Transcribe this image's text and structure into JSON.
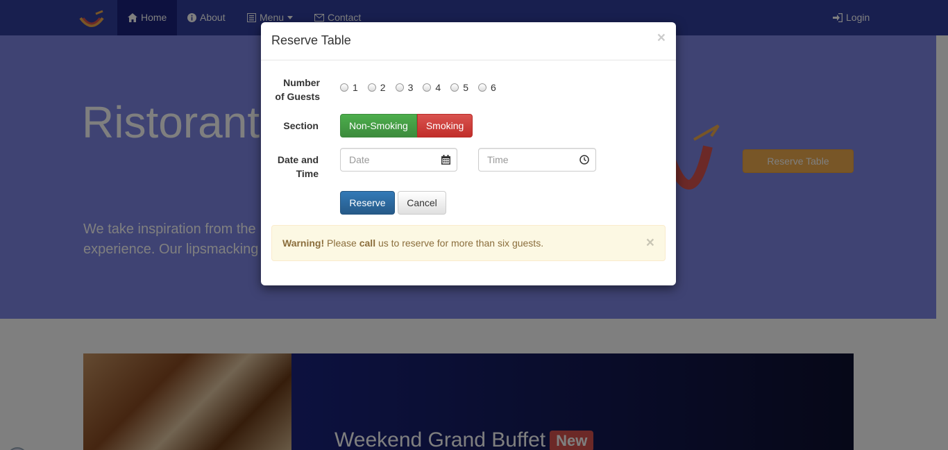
{
  "navbar": {
    "items": [
      {
        "label": "Home",
        "icon": "home-icon"
      },
      {
        "label": "About",
        "icon": "info-icon"
      },
      {
        "label": "Menu",
        "icon": "list-icon"
      },
      {
        "label": "Contact",
        "icon": "envelope-icon"
      }
    ],
    "login_label": "Login"
  },
  "jumbotron": {
    "title": "Ristorante",
    "text_line1": "We take inspiration from the",
    "text_line2": "experience. Our lipsmacking",
    "reserve_label": "Reserve Table"
  },
  "featured": {
    "title": "Weekend Grand Buffet",
    "badge": "New"
  },
  "modal": {
    "title": "Reserve Table",
    "close": "×",
    "guests_label_line1": "Number",
    "guests_label_line2": "of Guests",
    "guest_options": [
      "1",
      "2",
      "3",
      "4",
      "5",
      "6"
    ],
    "section_label": "Section",
    "section_options": [
      "Non-Smoking",
      "Smoking"
    ],
    "datetime_label_line1": "Date and",
    "datetime_label_line2": "Time",
    "date_placeholder": "Date",
    "time_placeholder": "Time",
    "reserve_button": "Reserve",
    "cancel_button": "Cancel",
    "alert": {
      "strong": "Warning!",
      "text1": " Please ",
      "call": "call",
      "text2": " us to reserve for more than six guests.",
      "close": "×"
    }
  },
  "colors": {
    "navbar": "#303f9f",
    "accent_green": "#4cae4c",
    "accent_red": "#d9534f",
    "primary": "#337ab7",
    "warning_bg": "#fcf8e3"
  }
}
